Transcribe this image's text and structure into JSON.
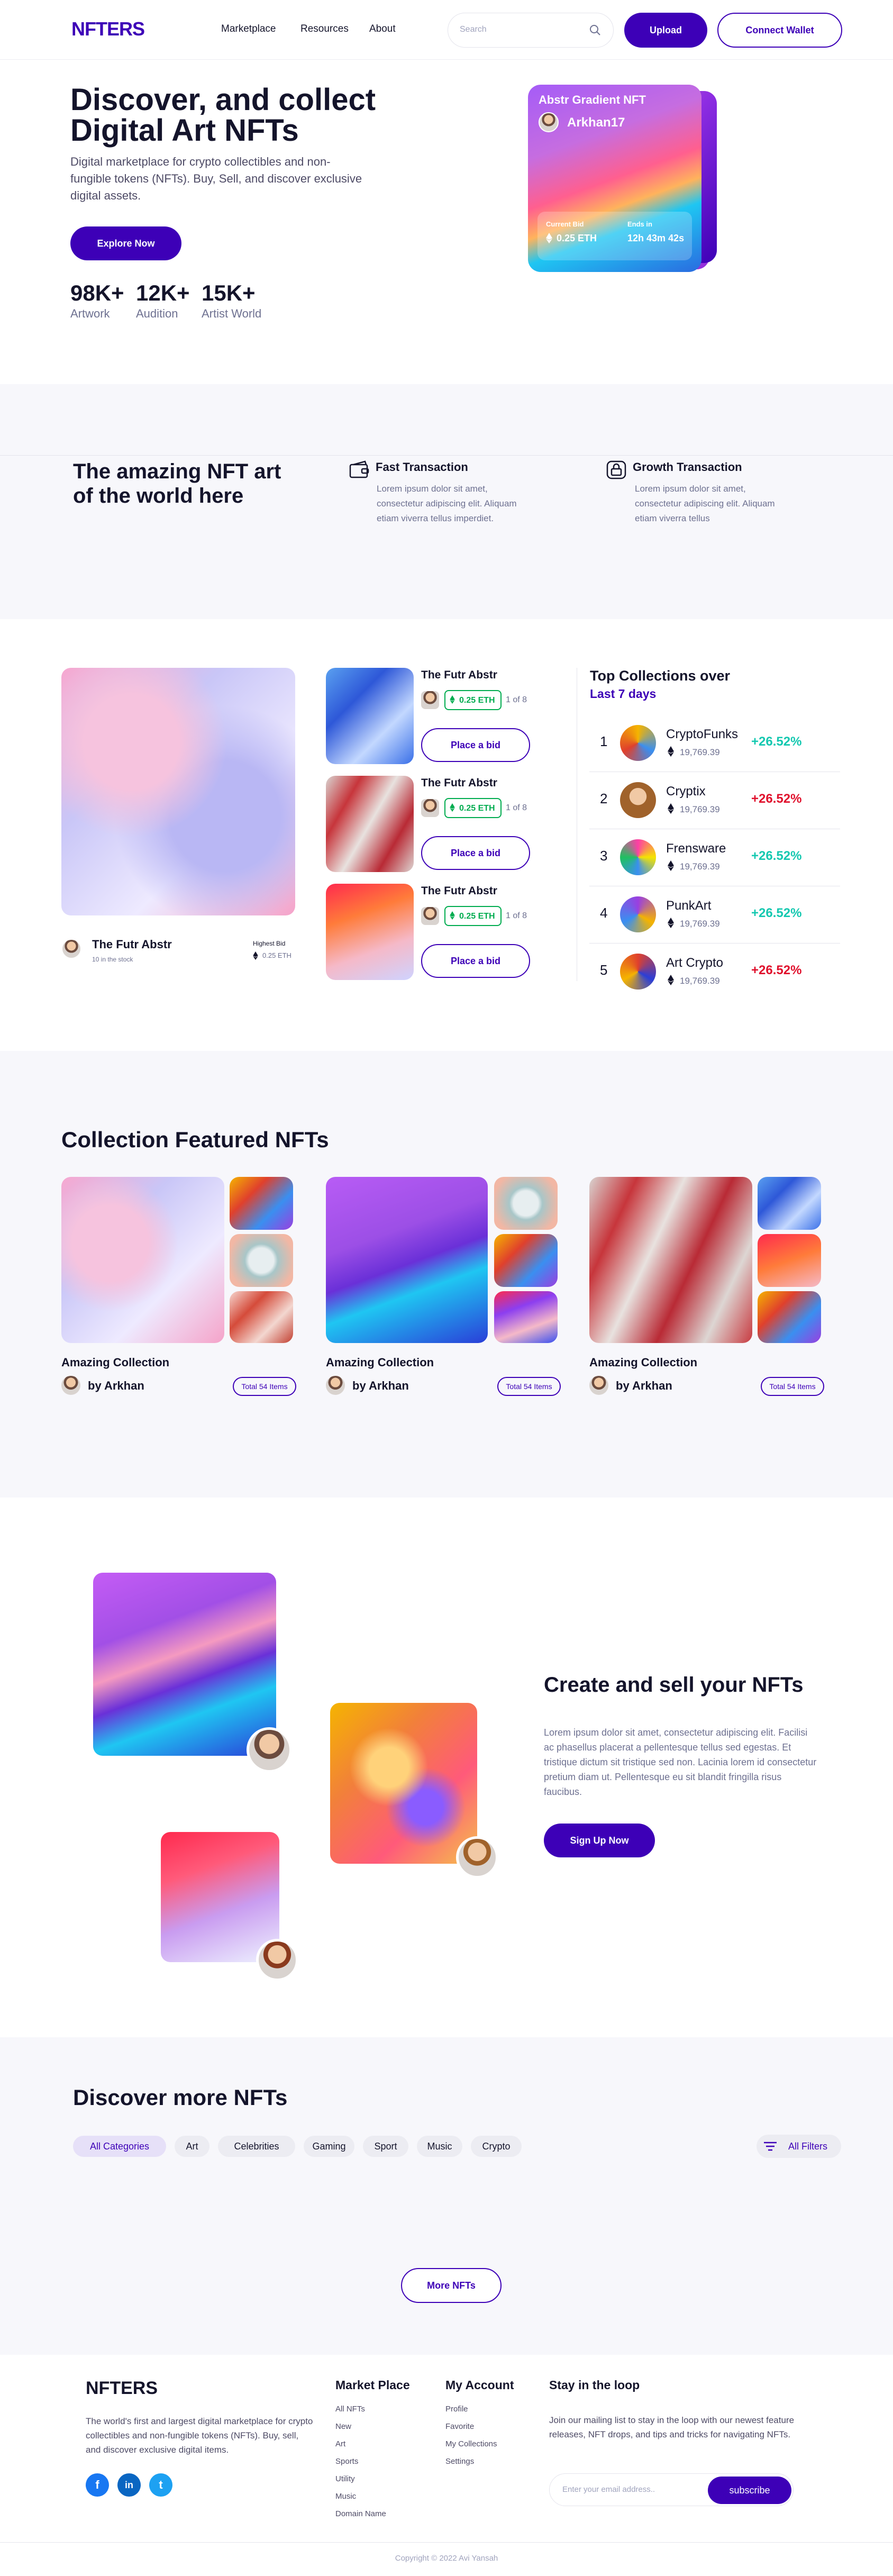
{
  "nav": {
    "logo": "NFTERS",
    "links": [
      "Marketplace",
      "Resources",
      "About"
    ],
    "search_placeholder": "Search",
    "upload": "Upload",
    "connect": "Connect Wallet"
  },
  "hero": {
    "title": "Discover, and collect Digital Art NFTs",
    "subtitle": "Digital marketplace for crypto collectibles and non-fungible tokens (NFTs). Buy, Sell, and discover exclusive digital assets.",
    "cta": "Explore Now",
    "stats": [
      {
        "value": "98K+",
        "label": "Artwork"
      },
      {
        "value": "12K+",
        "label": "Audition"
      },
      {
        "value": "15K+",
        "label": "Artist World"
      }
    ],
    "card": {
      "title": "Abstr Gradient NFT",
      "artist": "Arkhan17",
      "bid_label": "Current Bid",
      "bid_value": "0.25 ETH",
      "ends_label": "Ends in",
      "ends_value": "12h 43m 42s"
    }
  },
  "features": {
    "title": "The amazing NFT art of the world here",
    "items": [
      {
        "title": "Fast Transaction",
        "text": "Lorem ipsum dolor sit amet, consectetur adipiscing elit. Aliquam etiam viverra tellus imperdiet."
      },
      {
        "title": "Growth Transaction",
        "text": "Lorem ipsum dolor sit amet, consectetur adipiscing elit. Aliquam etiam viverra tellus"
      }
    ]
  },
  "auction": {
    "featured": {
      "name": "The Futr Abstr",
      "stock": "10 in the stock",
      "bid_label": "Highest Bid",
      "bid_value": "0.25 ETH"
    },
    "items": [
      {
        "name": "The Futr Abstr",
        "price": "0.25 ETH",
        "of": "1 of 8",
        "button": "Place a bid"
      },
      {
        "name": "The Futr Abstr",
        "price": "0.25 ETH",
        "of": "1 of 8",
        "button": "Place a bid"
      },
      {
        "name": "The Futr Abstr",
        "price": "0.25 ETH",
        "of": "1 of 8",
        "button": "Place a bid"
      }
    ]
  },
  "top": {
    "title": "Top Collections over",
    "period": "Last 7 days",
    "rows": [
      {
        "rank": "1",
        "name": "CryptoFunks",
        "value": "19,769.39",
        "change": "+26.52%",
        "up": true
      },
      {
        "rank": "2",
        "name": "Cryptix",
        "value": "19,769.39",
        "change": "+26.52%",
        "up": false
      },
      {
        "rank": "3",
        "name": "Frensware",
        "value": "19,769.39",
        "change": "+26.52%",
        "up": true
      },
      {
        "rank": "4",
        "name": "PunkArt",
        "value": "19,769.39",
        "change": "+26.52%",
        "up": true
      },
      {
        "rank": "5",
        "name": "Art Crypto",
        "value": "19,769.39",
        "change": "+26.52%",
        "up": false
      }
    ],
    "up_color": "#14c8b0",
    "down_color": "#e0102c"
  },
  "collections": {
    "title": "Collection Featured NFTs",
    "items": [
      {
        "title": "Amazing Collection",
        "by": "by Arkhan",
        "total": "Total 54 Items"
      },
      {
        "title": "Amazing Collection",
        "by": "by Arkhan",
        "total": "Total 54 Items"
      },
      {
        "title": "Amazing Collection",
        "by": "by Arkhan",
        "total": "Total 54 Items"
      }
    ]
  },
  "create": {
    "title": "Create and sell your NFTs",
    "text": "Lorem ipsum dolor sit amet, consectetur adipiscing elit. Facilisi ac phasellus placerat a pellentesque tellus sed egestas. Et tristique dictum sit tristique sed non. Lacinia lorem id consectetur pretium diam ut. Pellentesque eu sit blandit fringilla risus faucibus.",
    "cta": "Sign Up Now"
  },
  "discover": {
    "title": "Discover more NFTs",
    "categories": [
      "All Categories",
      "Art",
      "Celebrities",
      "Gaming",
      "Sport",
      "Music",
      "Crypto"
    ],
    "filters": "All Filters",
    "more": "More NFTs"
  },
  "footer": {
    "logo": "NFTERS",
    "text": "The world's first and largest digital marketplace for crypto collectibles and non-fungible tokens (NFTs). Buy, sell, and discover exclusive digital items.",
    "market_title": "Market Place",
    "market_links": [
      "All NFTs",
      "New",
      "Art",
      "Sports",
      "Utility",
      "Music",
      "Domain Name"
    ],
    "account_title": "My Account",
    "account_links": [
      "Profile",
      "Favorite",
      "My Collections",
      "Settings"
    ],
    "loop_title": "Stay in the loop",
    "loop_text": "Join our mailing list to stay in the loop with our newest feature releases, NFT drops, and tips and tricks for navigating NFTs.",
    "email_placeholder": "Enter your email address..",
    "subscribe": "subscribe",
    "copyright": "Copyright © 2022 Avi Yansah"
  },
  "colors": {
    "brand": "#3d00b7",
    "green": "#00ac4f"
  }
}
